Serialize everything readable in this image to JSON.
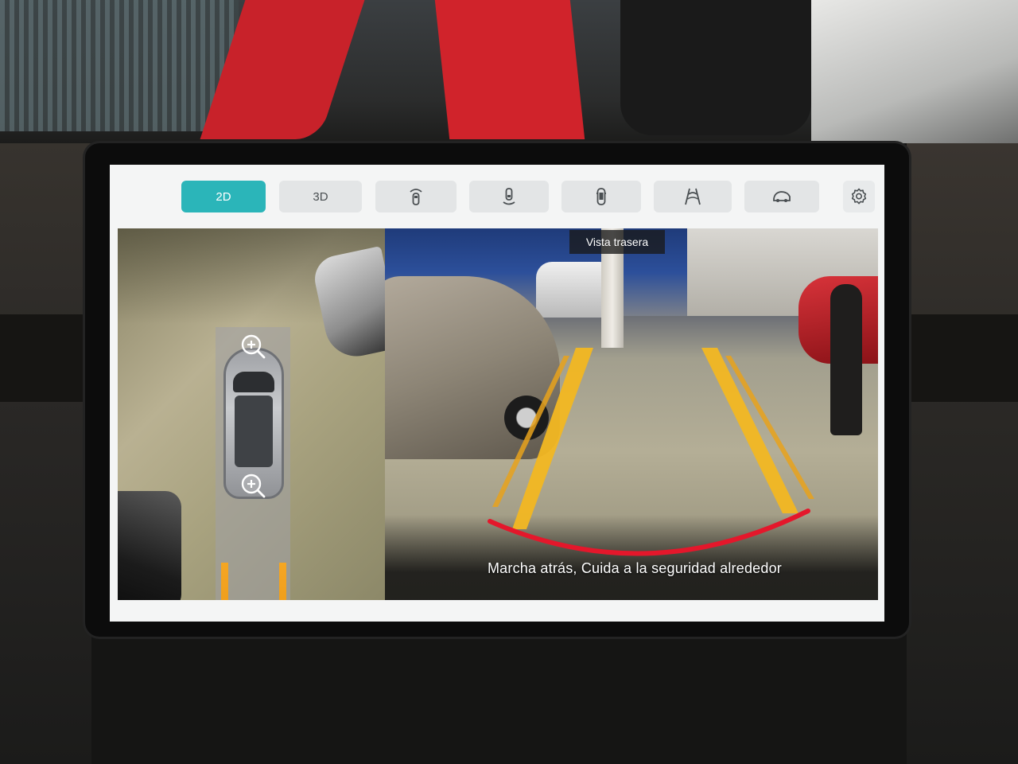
{
  "toolbar": {
    "mode_2d_label": "2D",
    "mode_3d_label": "3D",
    "active_mode": "2D",
    "view_buttons": [
      {
        "icon": "car-front-sensor-icon"
      },
      {
        "icon": "car-rear-sensor-icon"
      },
      {
        "icon": "car-top-view-icon"
      },
      {
        "icon": "trajectory-lines-icon"
      },
      {
        "icon": "car-side-view-icon"
      }
    ],
    "settings_icon": "gear-icon"
  },
  "birdseye": {
    "zoom_icon": "zoom-in-icon"
  },
  "rear_camera": {
    "view_label": "Vista trasera",
    "warning_text": "Marcha atrás, Cuida a la seguridad alrededor"
  },
  "colors": {
    "accent": "#2bb5b9",
    "guide_line": "#f5a623",
    "stop_line": "#e4172b"
  }
}
